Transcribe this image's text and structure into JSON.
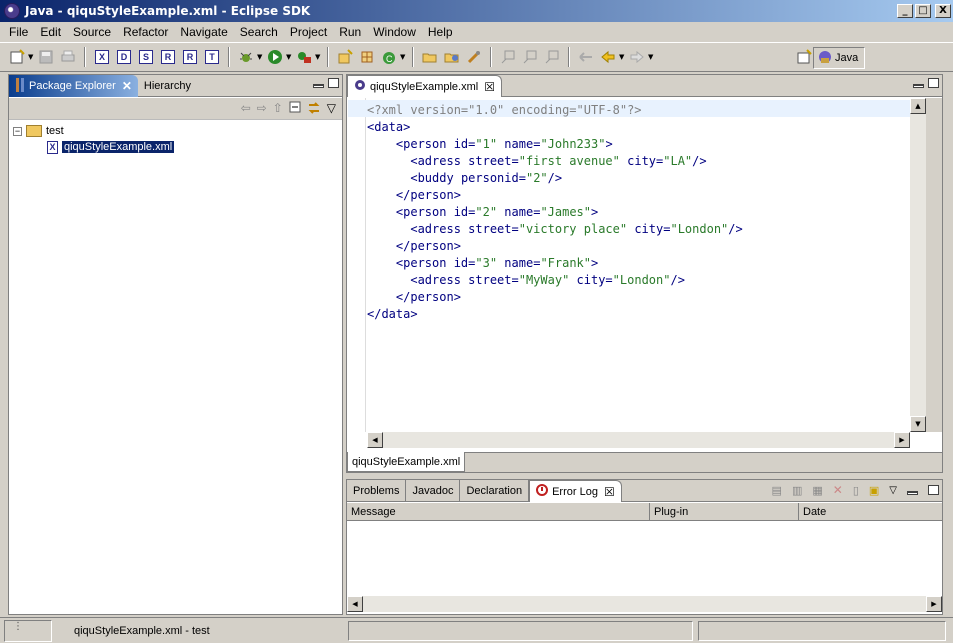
{
  "window": {
    "title": "Java - qiquStyleExample.xml - Eclipse SDK",
    "controls": {
      "minimize": "_",
      "maximize": "□",
      "close": "X"
    }
  },
  "menu": [
    "File",
    "Edit",
    "Source",
    "Refactor",
    "Navigate",
    "Search",
    "Project",
    "Run",
    "Window",
    "Help"
  ],
  "toolbar": {
    "new_icon": "new-wizard-icon",
    "save_icon": "save-icon",
    "print_icon": "print-icon",
    "xml_wizard_letters": [
      "X",
      "D",
      "S",
      "R",
      "R",
      "T"
    ],
    "debug_icon": "debug-icon",
    "run_icon": "run-icon",
    "external_tools_icon": "external-tools-icon",
    "perspective_label": "Java"
  },
  "package_explorer": {
    "tabs": [
      {
        "label": "Package Explorer",
        "close": "✕"
      },
      {
        "label": "Hierarchy"
      }
    ],
    "tree": [
      {
        "label": "test",
        "expander": "−",
        "type": "project"
      },
      {
        "label": "qiquStyleExample.xml",
        "type": "xml-file",
        "selected": true
      }
    ]
  },
  "editor": {
    "tab_label": "qiquStyleExample.xml",
    "tab_close": "☒",
    "bottom_tab": "qiquStyleExample.xml",
    "lines": [
      {
        "indent": "",
        "parts": [
          {
            "t": "<?xml version=\"1.0\" encoding=\"UTF-8\"?>",
            "c": "gray"
          }
        ]
      },
      {
        "indent": "",
        "parts": [
          {
            "t": "<data>",
            "c": "tag"
          }
        ]
      },
      {
        "indent": "    ",
        "parts": [
          {
            "t": "<person ",
            "c": "tag"
          },
          {
            "t": "id=",
            "c": "attr"
          },
          {
            "t": "\"1\"",
            "c": "val"
          },
          {
            "t": " name=",
            "c": "attr"
          },
          {
            "t": "\"John233\"",
            "c": "val"
          },
          {
            "t": ">",
            "c": "tag"
          }
        ]
      },
      {
        "indent": "      ",
        "parts": [
          {
            "t": "<adress ",
            "c": "tag"
          },
          {
            "t": "street=",
            "c": "attr"
          },
          {
            "t": "\"first avenue\"",
            "c": "val"
          },
          {
            "t": " city=",
            "c": "attr"
          },
          {
            "t": "\"LA\"",
            "c": "val"
          },
          {
            "t": "/>",
            "c": "tag"
          }
        ]
      },
      {
        "indent": "      ",
        "parts": [
          {
            "t": "<buddy ",
            "c": "tag"
          },
          {
            "t": "personid=",
            "c": "attr"
          },
          {
            "t": "\"2\"",
            "c": "val"
          },
          {
            "t": "/>",
            "c": "tag"
          }
        ]
      },
      {
        "indent": "    ",
        "parts": [
          {
            "t": "</person>",
            "c": "tag"
          }
        ]
      },
      {
        "indent": "    ",
        "parts": [
          {
            "t": "<person ",
            "c": "tag"
          },
          {
            "t": "id=",
            "c": "attr"
          },
          {
            "t": "\"2\"",
            "c": "val"
          },
          {
            "t": " name=",
            "c": "attr"
          },
          {
            "t": "\"James\"",
            "c": "val"
          },
          {
            "t": ">",
            "c": "tag"
          }
        ]
      },
      {
        "indent": "      ",
        "parts": [
          {
            "t": "<adress ",
            "c": "tag"
          },
          {
            "t": "street=",
            "c": "attr"
          },
          {
            "t": "\"victory place\"",
            "c": "val"
          },
          {
            "t": " city=",
            "c": "attr"
          },
          {
            "t": "\"London\"",
            "c": "val"
          },
          {
            "t": "/>",
            "c": "tag"
          }
        ]
      },
      {
        "indent": "    ",
        "parts": [
          {
            "t": "</person>",
            "c": "tag"
          }
        ]
      },
      {
        "indent": "    ",
        "parts": [
          {
            "t": "<person ",
            "c": "tag"
          },
          {
            "t": "id=",
            "c": "attr"
          },
          {
            "t": "\"3\"",
            "c": "val"
          },
          {
            "t": " name=",
            "c": "attr"
          },
          {
            "t": "\"Frank\"",
            "c": "val"
          },
          {
            "t": ">",
            "c": "tag"
          }
        ]
      },
      {
        "indent": "      ",
        "parts": [
          {
            "t": "<adress ",
            "c": "tag"
          },
          {
            "t": "street=",
            "c": "attr"
          },
          {
            "t": "\"MyWay\"",
            "c": "val"
          },
          {
            "t": " city=",
            "c": "attr"
          },
          {
            "t": "\"London\"",
            "c": "val"
          },
          {
            "t": "/>",
            "c": "tag"
          }
        ]
      },
      {
        "indent": "    ",
        "parts": [
          {
            "t": "</person>",
            "c": "tag"
          }
        ]
      },
      {
        "indent": "",
        "parts": [
          {
            "t": "</data>",
            "c": "tag"
          }
        ]
      }
    ]
  },
  "bottom_panel": {
    "tabs": [
      {
        "label": "Problems"
      },
      {
        "label": "Javadoc"
      },
      {
        "label": "Declaration"
      },
      {
        "label": "Error Log",
        "close": "☒",
        "active": true
      }
    ],
    "columns": [
      "Message",
      "Plug-in",
      "Date"
    ]
  },
  "status": {
    "text": "qiquStyleExample.xml - test",
    "grip": "⋮"
  },
  "colors": {
    "title_start": "#0a246a",
    "title_end": "#a6caf0",
    "chrome": "#d4d0c8",
    "xml_tag": "#000080",
    "xml_value": "#2a7a2a",
    "xml_decl": "#808080",
    "selection": "#0a246a"
  }
}
